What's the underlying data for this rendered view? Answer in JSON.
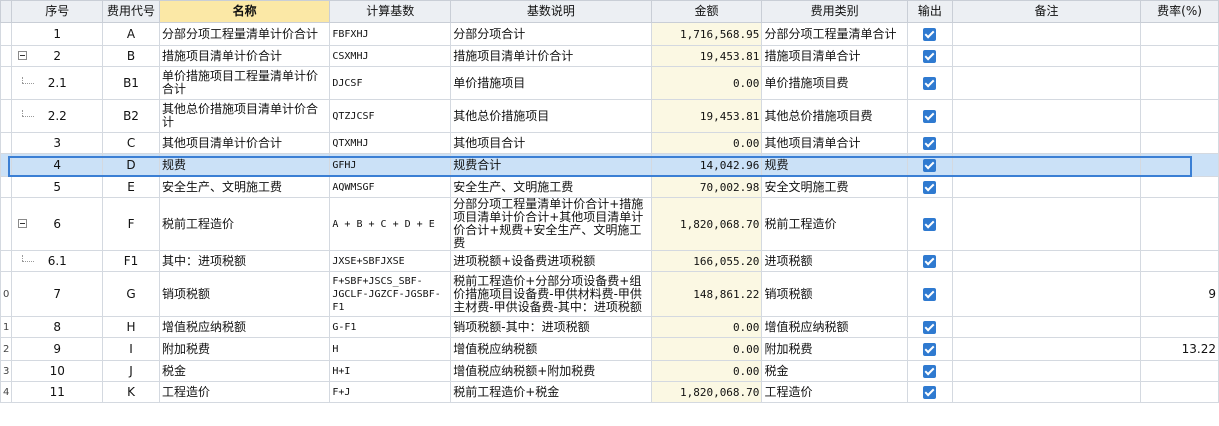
{
  "columns": [
    "序号",
    "费用代号",
    "名称",
    "计算基数",
    "基数说明",
    "金额",
    "费用类别",
    "输出",
    "备注",
    "费率(%)"
  ],
  "rows": [
    {
      "gutter": "",
      "seq": "1",
      "code": "A",
      "name": "分部分项工程量清单计价合计",
      "base": "FBFXHJ",
      "desc": "分部分项合计",
      "amount": "1,716,568.95",
      "category": "分部分项工程量清单合计",
      "output": true,
      "note": "",
      "rate": "",
      "tree": "none"
    },
    {
      "gutter": "",
      "seq": "2",
      "code": "B",
      "name": "措施项目清单计价合计",
      "base": "CSXMHJ",
      "desc": "措施项目清单计价合计",
      "amount": "19,453.81",
      "category": "措施项目清单合计",
      "output": true,
      "note": "",
      "rate": "",
      "tree": "expand"
    },
    {
      "gutter": "",
      "seq": "2.1",
      "code": "B1",
      "name": "单价措施项目工程量清单计价合计",
      "base": "DJCSF",
      "desc": "单价措施项目",
      "amount": "0.00",
      "category": "单价措施项目费",
      "output": true,
      "note": "",
      "rate": "",
      "tree": "child"
    },
    {
      "gutter": "",
      "seq": "2.2",
      "code": "B2",
      "name": "其他总价措施项目清单计价合计",
      "base": "QTZJCSF",
      "desc": "其他总价措施项目",
      "amount": "19,453.81",
      "category": "其他总价措施项目费",
      "output": true,
      "note": "",
      "rate": "",
      "tree": "child"
    },
    {
      "gutter": "",
      "seq": "3",
      "code": "C",
      "name": "其他项目清单计价合计",
      "base": "QTXMHJ",
      "desc": "其他项目合计",
      "amount": "0.00",
      "category": "其他项目清单合计",
      "output": true,
      "note": "",
      "rate": "",
      "tree": "none"
    },
    {
      "gutter": "",
      "seq": "4",
      "code": "D",
      "name": "规费",
      "base": "GFHJ",
      "desc": "规费合计",
      "amount": "14,042.96",
      "category": "规费",
      "output": true,
      "note": "",
      "rate": "",
      "tree": "none",
      "selected": true
    },
    {
      "gutter": "",
      "seq": "5",
      "code": "E",
      "name": "安全生产、文明施工费",
      "base": "AQWMSGF",
      "desc": "安全生产、文明施工费",
      "amount": "70,002.98",
      "category": "安全文明施工费",
      "output": true,
      "note": "",
      "rate": "",
      "tree": "none"
    },
    {
      "gutter": "",
      "seq": "6",
      "code": "F",
      "name": "税前工程造价",
      "base": "A + B + C + D + E",
      "desc": "分部分项工程量清单计价合计+措施项目清单计价合计+其他项目清单计价合计+规费+安全生产、文明施工费",
      "amount": "1,820,068.70",
      "category": "税前工程造价",
      "output": true,
      "note": "",
      "rate": "",
      "tree": "expand"
    },
    {
      "gutter": "",
      "seq": "6.1",
      "code": "F1",
      "name": "其中：进项税额",
      "base": "JXSE+SBFJXSE",
      "desc": "进项税额+设备费进项税额",
      "amount": "166,055.20",
      "category": "进项税额",
      "output": true,
      "note": "",
      "rate": "",
      "tree": "child"
    },
    {
      "gutter": "0",
      "seq": "7",
      "code": "G",
      "name": "销项税额",
      "base": "F+SBF+JSCS_SBF-JGCLF-JGZCF-JGSBF-F1",
      "desc": "税前工程造价+分部分项设备费+组价措施项目设备费-甲供材料费-甲供主材费-甲供设备费-其中：进项税额",
      "amount": "148,861.22",
      "category": "销项税额",
      "output": true,
      "note": "",
      "rate": "9",
      "tree": "none"
    },
    {
      "gutter": "1",
      "seq": "8",
      "code": "H",
      "name": "增值税应纳税额",
      "base": "G-F1",
      "desc": "销项税额-其中：进项税额",
      "amount": "0.00",
      "category": "增值税应纳税额",
      "output": true,
      "note": "",
      "rate": "",
      "tree": "none"
    },
    {
      "gutter": "2",
      "seq": "9",
      "code": "I",
      "name": "附加税费",
      "base": "H",
      "desc": "增值税应纳税额",
      "amount": "0.00",
      "category": "附加税费",
      "output": true,
      "note": "",
      "rate": "13.22",
      "tree": "none"
    },
    {
      "gutter": "3",
      "seq": "10",
      "code": "J",
      "name": "税金",
      "base": "H+I",
      "desc": "增值税应纳税额+附加税费",
      "amount": "0.00",
      "category": "税金",
      "output": true,
      "note": "",
      "rate": "",
      "tree": "none"
    },
    {
      "gutter": "4",
      "seq": "11",
      "code": "K",
      "name": "工程造价",
      "base": "F+J",
      "desc": "税前工程造价+税金",
      "amount": "1,820,068.70",
      "category": "工程造价",
      "output": true,
      "note": "",
      "rate": "",
      "tree": "none"
    }
  ],
  "colors": {
    "selected_row": "#cbe1f7",
    "selected_border": "#3b7fd4",
    "amount_bg": "#fbf8e3",
    "checkbox": "#2f7ad0",
    "header_bg": "#eceff3",
    "active_header": "#fbe8a6"
  }
}
